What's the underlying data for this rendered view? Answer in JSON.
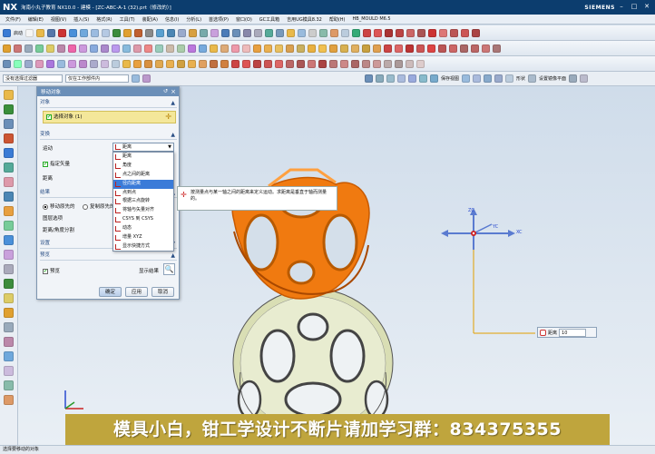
{
  "window": {
    "logo": "NX",
    "title": "洵南小丸子教育 NX10.0 - 建模 - [ZC-ABC-A-1 (32).prt（修改的）]",
    "brand": "SIEMENS"
  },
  "menu": [
    "文件(F)",
    "编辑(E)",
    "视图(V)",
    "插入(S)",
    "格式(R)",
    "工具(T)",
    "装配(A)",
    "信息(I)",
    "分析(L)",
    "首选项(P)",
    "窗口(O)",
    "GC工具箱",
    "吉用UG模具8.32",
    "帮助(H)",
    "HB_MOULD M6.5"
  ],
  "toolbar": {
    "start_label": "启动",
    "filter_value": "没有选择过滤器",
    "scope_value": "仅在工作部件内",
    "snap_label": "保存视图",
    "shape_label": "形状",
    "filter2_label": "设置镜像平面"
  },
  "dialog": {
    "title": "移动对象",
    "section_objects": "对象",
    "selected_objects": "选择对象 (1)",
    "section_transform": "变换",
    "motion_label": "运动",
    "motion_value": "距离",
    "specify_vector": "指定矢量",
    "distance_label": "距离",
    "section_result": "结果",
    "move_original": "移动原先的",
    "copy_original": "复制原先的",
    "layer_option": "图层选项",
    "distance_angle_split": "距离/角度分割",
    "section_settings": "设置",
    "section_preview": "预览",
    "preview_label": "预览",
    "show_result": "显示结果",
    "ok_label": "确定",
    "apply_label": "应用",
    "cancel_label": "取消"
  },
  "dropdown": {
    "items": [
      "距离",
      "角度",
      "点之间的距离",
      "径向距离",
      "点到点",
      "根据三点旋转",
      "将轴与矢量对齐",
      "CSYS 到 CSYS",
      "动态",
      "增量 XYZ",
      "显示快捷方式"
    ],
    "highlighted_index": 3
  },
  "tooltip": {
    "text": "按测量点与某一轴之间的距离来定义运动。求距离是垂直于轴而测量的。"
  },
  "viewport": {
    "axis_x": "XC",
    "axis_y": "YC",
    "axis_z": "ZC",
    "distance_label": "距离",
    "distance_value": "10"
  },
  "banner": {
    "text": "模具小白，钳工学设计不断片请加学习群：834375355"
  },
  "status": {
    "text": "选择要移动的对象"
  },
  "colors": {
    "title_bar": "#0c3d6e",
    "accent_orange": "#f07a10",
    "banner": "#bfa53d",
    "highlight": "#3b7bd8"
  }
}
